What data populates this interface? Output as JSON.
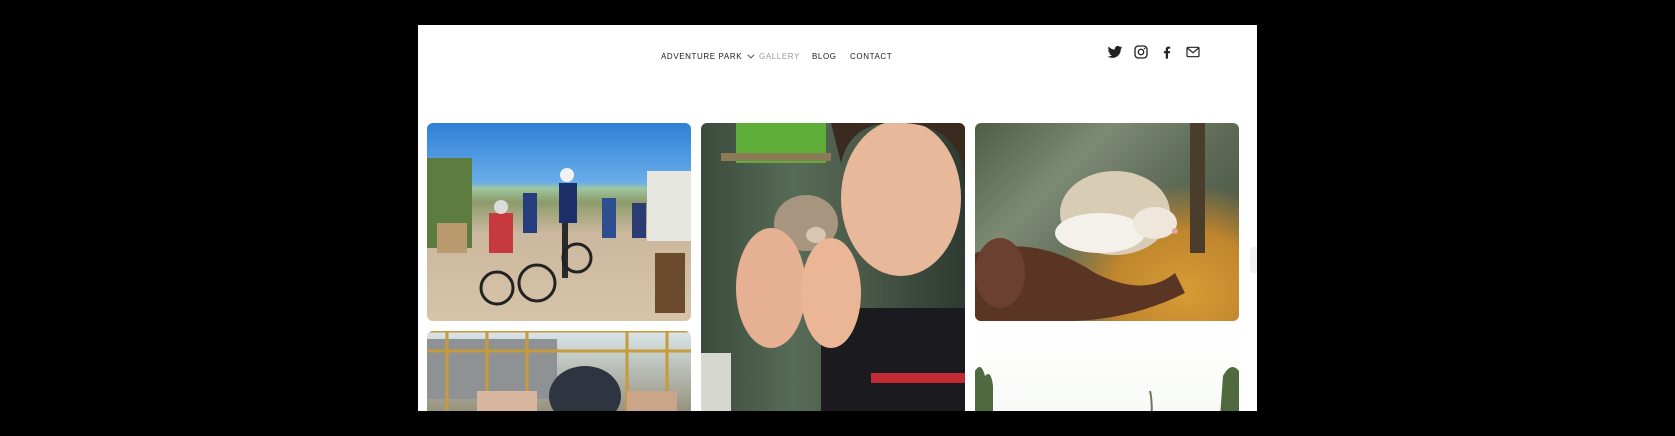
{
  "nav": {
    "items": [
      {
        "label": "ADVENTURE PARK",
        "has_dropdown": true,
        "active": false
      },
      {
        "label": "GALLERY",
        "has_dropdown": false,
        "active": true
      },
      {
        "label": "BLOG",
        "has_dropdown": false,
        "active": false
      },
      {
        "label": "CONTACT",
        "has_dropdown": false,
        "active": false
      }
    ]
  },
  "social": [
    "twitter-icon",
    "instagram-icon",
    "facebook-icon",
    "mail-icon"
  ],
  "gallery": {
    "tiles": [
      "cyclists-photo",
      "girl-with-hedgehog-photo",
      "hand-with-hedgehog-photo",
      "child-playground-photo",
      "outdoor-trees-photo"
    ]
  },
  "colors": {
    "background": "#000000",
    "page": "#ffffff",
    "nav_text": "#222222",
    "nav_active": "#9a9a9a"
  }
}
